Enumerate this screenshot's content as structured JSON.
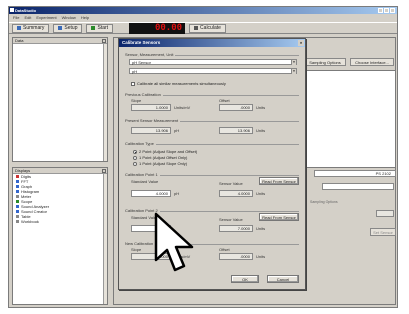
{
  "app": {
    "title": "DataStudio",
    "menu": [
      "File",
      "Edit",
      "Experiment",
      "Window",
      "Help"
    ],
    "toolbar": {
      "summary": "Summary",
      "setup": "Setup",
      "start": "Start",
      "display_value": "00.00",
      "calculate": "Calculate"
    }
  },
  "data_panel": {
    "title": "Data"
  },
  "displays_panel": {
    "title": "Displays",
    "items": [
      "Digits",
      "FFT",
      "Graph",
      "Histogram",
      "Meter",
      "Scope",
      "Sound Analyzer",
      "Sound Creator",
      "Table",
      "Workbook"
    ]
  },
  "background": {
    "sampling_options": "Sampling Options",
    "choose_interface": "Choose Interface...",
    "ph_value": "PS 2102",
    "sampling_options2": "Sampling Options",
    "set_sensor": "Set Sensor"
  },
  "dialog": {
    "title": "Calibrate Sensors",
    "sensor_section": "Sensor, Measurement, Unit",
    "sensor": "pH Sensor",
    "measurement": "pH",
    "calibrate_all": "Calibrate all similar measurements simultaneously",
    "previous_section": "Previous Calibration",
    "slope_label": "Slope",
    "offset_label": "Offset",
    "prev_slope": "1.0000",
    "prev_slope_unit": "Units/mV",
    "prev_offset": ".0000",
    "prev_offset_unit": "Units",
    "present_section": "Present Sensor Measurement",
    "present_value": "13.906",
    "present_unit": "pH",
    "present_raw": "13.906",
    "present_raw_unit": "Units",
    "type_section": "Calibration Type",
    "types": [
      "2 Point (Adjust Slope and Offset)",
      "1 Point (Adjust Offset Only)",
      "1 Point (Adjust Slope Only)"
    ],
    "point1_section": "Calibration Point 1",
    "standard_value": "Standard Value",
    "sensor_value": "Sensor Value",
    "read_from_sensor": "Read From Sensor",
    "p1_standard": "4.0000",
    "p1_standard_unit": "pH",
    "p1_sensor": "4.0000",
    "p1_sensor_unit": "Units",
    "point2_section": "Calibration Point 2",
    "p2_sensor": "7.0000",
    "p2_sensor_unit": "Units",
    "new_section": "New Calibration",
    "new_slope": "1.0000",
    "new_slope_unit": "Units/mV",
    "new_offset": ".0000",
    "new_offset_unit": "Units",
    "ok": "OK",
    "cancel": "Cancel"
  }
}
